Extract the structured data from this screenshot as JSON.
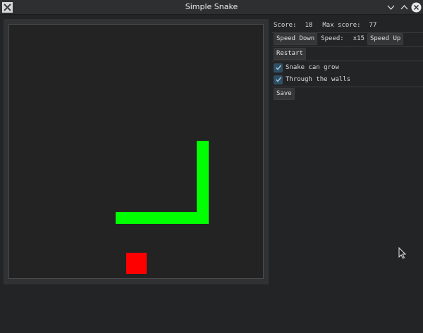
{
  "window": {
    "title": "Simple Snake"
  },
  "score": {
    "label": "Score:",
    "value": "18",
    "max_label": "Max score:",
    "max_value": "77"
  },
  "speed": {
    "down_label": "Speed Down",
    "label": "Speed:",
    "value": "x15",
    "up_label": "Speed Up"
  },
  "restart_label": "Restart",
  "options": [
    {
      "label": "Snake can grow",
      "checked": true
    },
    {
      "label": "Through the walls",
      "checked": true
    }
  ],
  "save_label": "Save",
  "colors": {
    "snake": "#00ff00",
    "food": "#ff0000",
    "board": "#232323",
    "checkbox": "#2f4f64"
  }
}
